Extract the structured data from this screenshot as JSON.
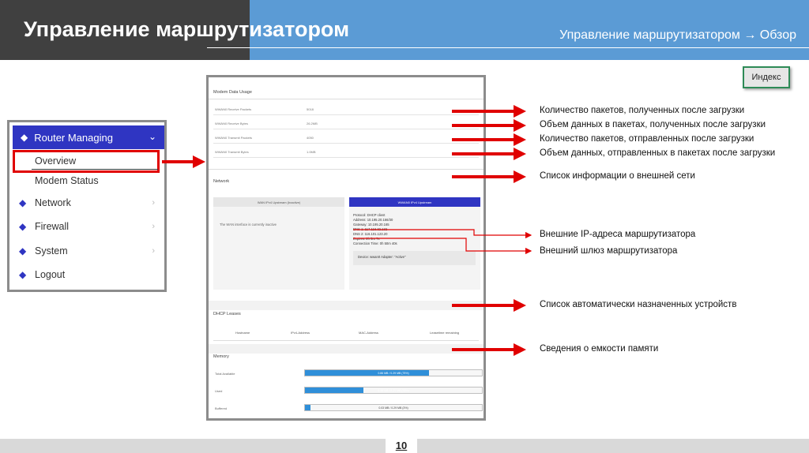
{
  "header": {
    "title": "Управление маршрутизатором",
    "breadcrumb": "Управление маршрутизатором → Обзор"
  },
  "index_button": "Индекс",
  "menu": {
    "heading": "Router Managing",
    "sub_items": [
      "Overview",
      "Modem Status"
    ],
    "items": [
      "Network",
      "Firewall",
      "System",
      "Logout"
    ]
  },
  "panel": {
    "modem_section": "Modem Data Usage",
    "modem_rows": [
      {
        "key": "WWAN0 Receive Packets",
        "value": "5018"
      },
      {
        "key": "WWAN0 Receive Bytes",
        "value": "26.2MB"
      },
      {
        "key": "WWAN0 Transmit Packets",
        "value": "4050"
      },
      {
        "key": "WWAN0 Transmit Bytes",
        "value": "1.0MB"
      }
    ],
    "network_section": "Network",
    "wan_inactive_header": "WAN IPv4 Upstream (Inactive)",
    "wan_inactive_text": "The WAN interface is currently inactive",
    "wan_active_header": "WWAN0 IPv4 Upstream",
    "wan_active_lines": [
      "Protocol: DHCP client",
      "Address: 10.195.20.166/30",
      "Gateway: 10.195.20.165",
      "DNS 1: 117.116.32.132",
      "DNS 2: 116.101.123.20",
      "Expires: 2h 5m 7s",
      "Connection Time: 0h 50m 40s"
    ],
    "wan_device": "Device: wwan0 Adapter: \"Active\"",
    "dhcp_section": "DHCP Leases",
    "dhcp_columns": [
      "Hostname",
      "IPv4-Address",
      "MAC-Address",
      "Leasetime remaining"
    ],
    "memory_section": "Memory",
    "memory_rows": [
      {
        "label": "Total Available",
        "value": "0.86 MB / 0.29 MB (75%)",
        "percent": 70
      },
      {
        "label": "Used",
        "value": "0.36 MB / 0.29 MB (33%)",
        "percent": 33
      },
      {
        "label": "Buffered",
        "value": "0.03 MB / 0.29 MB (3%)",
        "percent": 3
      }
    ]
  },
  "annotations": [
    "Количество пакетов, полученных после загрузки",
    "Объем данных в пакетах, полученных после загрузки",
    "Количество пакетов, отправленных после загрузки",
    "Объем данных, отправленных в пакетах после загрузки",
    "Список информации о внешней сети",
    "Внешние IP-адреса маршрутизатора",
    "Внешний шлюз маршрутизатора",
    "Список автоматически назначенных устройств",
    "Сведения о емкости памяти"
  ],
  "page_number": "10",
  "colors": {
    "header_dark": "#404040",
    "header_blue": "#5b9bd5",
    "menu_accent": "#2f35c2",
    "arrow_red": "#e00000",
    "memory_bar": "#2f8fd9"
  }
}
